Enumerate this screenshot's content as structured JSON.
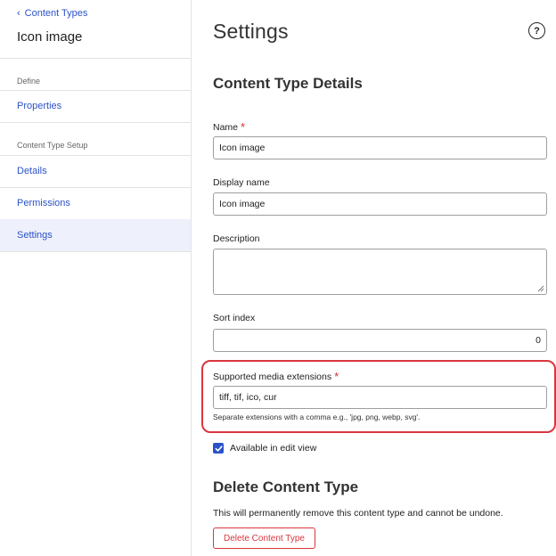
{
  "sidebar": {
    "back_link": "Content Types",
    "title": "Icon image",
    "sections": [
      {
        "label": "Define"
      },
      {
        "label": "Content Type Setup"
      }
    ],
    "items": [
      {
        "label": "Properties"
      },
      {
        "label": "Details"
      },
      {
        "label": "Permissions"
      },
      {
        "label": "Settings",
        "active": true
      }
    ]
  },
  "main": {
    "title": "Settings",
    "help_icon": "?",
    "details_title": "Content Type Details",
    "fields": {
      "name": {
        "label": "Name",
        "value": "Icon image",
        "required": true
      },
      "display_name": {
        "label": "Display name",
        "value": "Icon image"
      },
      "description": {
        "label": "Description",
        "value": ""
      },
      "sort_index": {
        "label": "Sort index",
        "value": "0"
      },
      "media_extensions": {
        "label": "Supported media extensions",
        "value": "tiff, tif, ico, cur",
        "required": true,
        "helper": "Separate extensions with a comma e.g., 'jpg, png, webp, svg'."
      }
    },
    "available_in_edit_view": {
      "label": "Available in edit view",
      "checked": true
    },
    "delete": {
      "title": "Delete Content Type",
      "description": "This will permanently remove this content type and cannot be undone.",
      "button_label": "Delete Content Type"
    },
    "required_mark": "*"
  },
  "colors": {
    "accent": "#2b52c9",
    "danger": "#d9363e",
    "active_bg": "#eef0fb"
  },
  "icons": [
    "chevron-left-icon",
    "help-circle-icon",
    "check-icon",
    "resize-grip-icon"
  ]
}
